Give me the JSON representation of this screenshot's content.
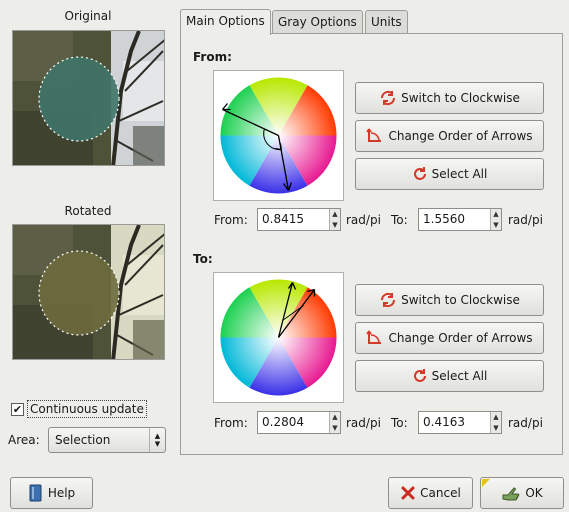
{
  "previews": {
    "original_caption": "Original",
    "rotated_caption": "Rotated"
  },
  "continuous_update": {
    "label": "Continuous update",
    "checked": true
  },
  "area": {
    "label": "Area:",
    "value": "Selection"
  },
  "tabs": [
    {
      "label": "Main Options",
      "active": true
    },
    {
      "label": "Gray Options",
      "active": false
    },
    {
      "label": "Units",
      "active": false
    }
  ],
  "from_section": {
    "title": "From:",
    "buttons": {
      "switch": "Switch to Clockwise",
      "change_order": "Change Order of Arrows",
      "select_all": "Select All"
    },
    "from_label": "From:",
    "from_value": "0.8415",
    "from_unit": "rad/pi",
    "to_label": "To:",
    "to_value": "1.5560",
    "to_unit": "rad/pi"
  },
  "to_section": {
    "title": "To:",
    "buttons": {
      "switch": "Switch to Clockwise",
      "change_order": "Change Order of Arrows",
      "select_all": "Select All"
    },
    "from_label": "From:",
    "from_value": "0.2804",
    "from_unit": "rad/pi",
    "to_label": "To:",
    "to_value": "0.4163",
    "to_unit": "rad/pi"
  },
  "bottom_buttons": {
    "help": "Help",
    "cancel": "Cancel",
    "ok": "OK"
  },
  "colors": {
    "accent_red": "#d23a2a",
    "help_blue": "#3a6fb0",
    "ok_green": "#5a8a3a"
  }
}
